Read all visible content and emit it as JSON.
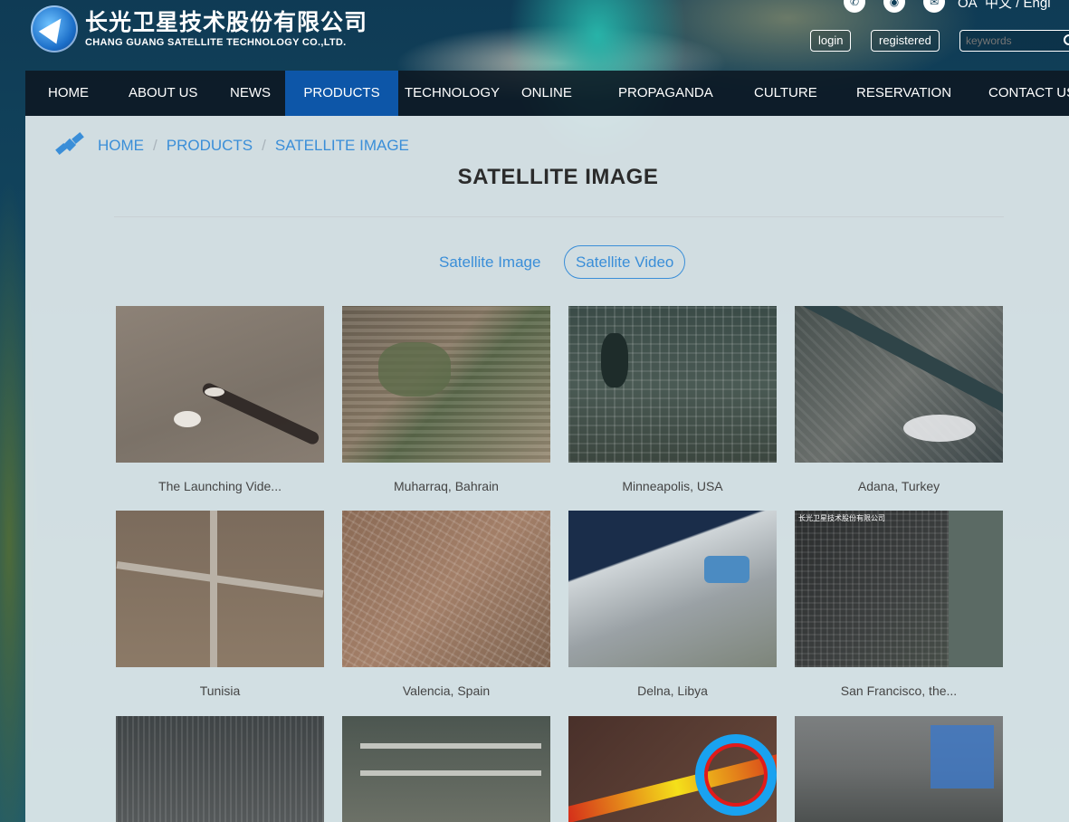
{
  "header": {
    "logo_cn": "长光卫星技术股份有限公司",
    "logo_en": "CHANG GUANG SATELLITE TECHNOLOGY CO.,LTD.",
    "oa": "OA",
    "lang": "中文 / Engl",
    "login": "login",
    "registered": "registered",
    "search_placeholder": "keywords"
  },
  "nav": [
    {
      "label": "HOME"
    },
    {
      "label": "ABOUT US"
    },
    {
      "label": "NEWS"
    },
    {
      "label": "PRODUCTS"
    },
    {
      "label": "TECHNOLOGY"
    },
    {
      "label": "ONLINE"
    },
    {
      "label": "PROPAGANDA"
    },
    {
      "label": "CULTURE"
    },
    {
      "label": "RESERVATION"
    },
    {
      "label": "CONTACT US"
    }
  ],
  "breadcrumb": [
    "HOME",
    "PRODUCTS",
    "SATELLITE IMAGE"
  ],
  "page_title": "SATELLITE IMAGE",
  "tabs": [
    "Satellite Image",
    "Satellite Video"
  ],
  "cards": [
    {
      "caption": "The Launching Vide..."
    },
    {
      "caption": "Muharraq, Bahrain"
    },
    {
      "caption": "Minneapolis, USA"
    },
    {
      "caption": "Adana, Turkey"
    },
    {
      "caption": "Tunisia"
    },
    {
      "caption": "Valencia, Spain"
    },
    {
      "caption": "Delna, Libya"
    },
    {
      "caption": "San Francisco, the..."
    }
  ],
  "thumb_badge": "长光卫星技术股份有限公司"
}
